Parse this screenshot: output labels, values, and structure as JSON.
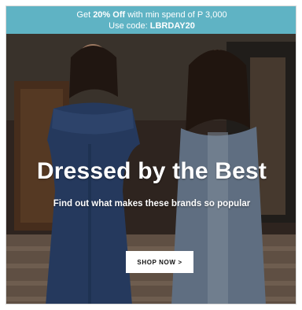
{
  "colors": {
    "promo_bg": "#5fb3c4",
    "frame_border": "#d8d8d8",
    "cta_bg": "#ffffff",
    "cta_text": "#111111"
  },
  "promo": {
    "prefix": "Get ",
    "discount": "20% Off",
    "suffix": " with min spend of P 3,000",
    "code_prefix": "Use code: ",
    "code": "LBRDAY20"
  },
  "hero": {
    "headline": "Dressed by the Best",
    "subheadline": "Find out what makes these brands so popular",
    "cta_label": "SHOP NOW >"
  }
}
